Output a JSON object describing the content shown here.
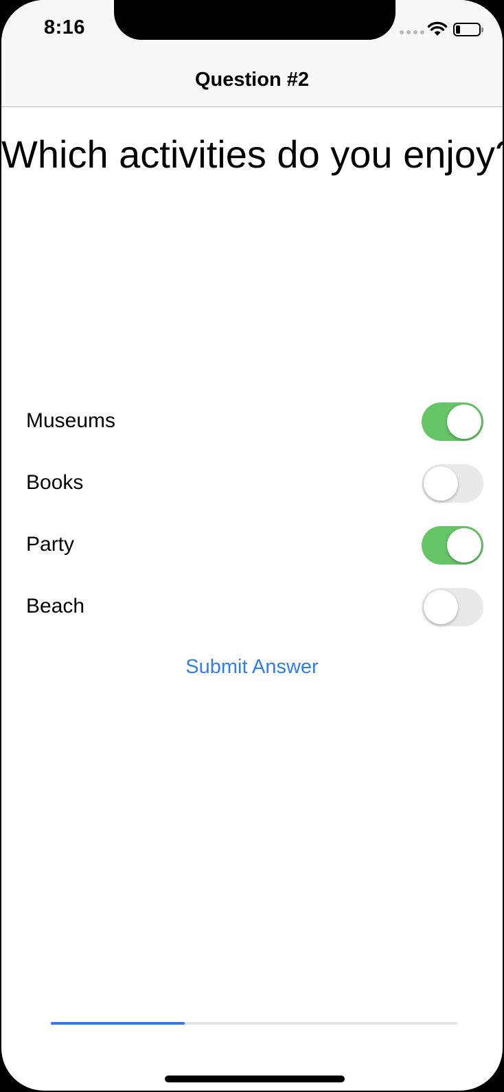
{
  "status_bar": {
    "time": "8:16",
    "icons": [
      "cellular-signal-icon",
      "wifi-icon",
      "battery-icon"
    ],
    "battery_level": 0.2
  },
  "nav": {
    "title": "Question #2"
  },
  "question": {
    "text": "Which activities do you enjoy?"
  },
  "options": [
    {
      "label": "Museums",
      "on": true
    },
    {
      "label": "Books",
      "on": false
    },
    {
      "label": "Party",
      "on": true
    },
    {
      "label": "Beach",
      "on": false
    }
  ],
  "submit": {
    "label": "Submit Answer"
  },
  "progress": {
    "fraction": 0.33
  },
  "colors": {
    "accent": "#2e7ef0",
    "toggle_on": "#65c466",
    "toggle_off": "#e9e9ea"
  }
}
